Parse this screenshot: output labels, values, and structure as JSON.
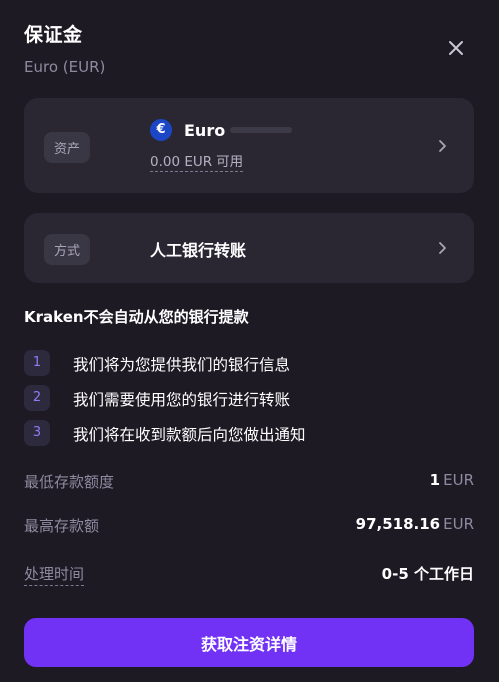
{
  "modal": {
    "title": "保证金",
    "subtitle": "Euro (EUR)"
  },
  "asset": {
    "chip": "资产",
    "currency_symbol": "€",
    "name": "Euro",
    "available_amount": "0.00 EUR",
    "available_suffix": "可用"
  },
  "method": {
    "chip": "方式",
    "name": "人工银行转账"
  },
  "notice": "Kraken不会自动从您的银行提款",
  "steps": [
    {
      "num": "1",
      "text": "我们将为您提供我们的银行信息"
    },
    {
      "num": "2",
      "text": "我们需要使用您的银行进行转账"
    },
    {
      "num": "3",
      "text": "我们将在收到款额后向您做出通知"
    }
  ],
  "limits": {
    "min_label": "最低存款额度",
    "min_value": "1",
    "min_unit": "EUR",
    "max_label": "最高存款额",
    "max_value": "97,518.16",
    "max_unit": "EUR",
    "time_label": "处理时间",
    "time_value": "0-5 个工作日"
  },
  "cta_label": "获取注资详情",
  "colors": {
    "background": "#1d1a24",
    "card": "#2a2733",
    "accent": "#7132f5",
    "euro_badge": "#1b47c7"
  }
}
